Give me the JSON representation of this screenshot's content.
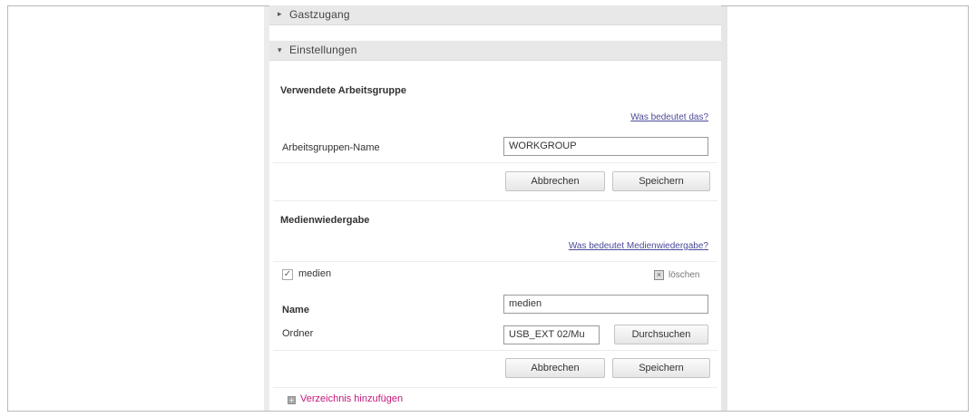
{
  "sections": {
    "guest_access": {
      "arrow": "▸",
      "title": "Gastzugang"
    },
    "settings": {
      "arrow": "▾",
      "title": "Einstellungen"
    }
  },
  "workgroup": {
    "heading": "Verwendete Arbeitsgruppe",
    "help_link": "Was bedeutet das?",
    "name_label": "Arbeitsgruppen-Name",
    "name_value": "WORKGROUP",
    "cancel_label": "Abbrechen",
    "save_label": "Speichern"
  },
  "media": {
    "heading": "Medienwiedergabe",
    "help_link": "Was bedeutet Medienwiedergabe?",
    "share_name": "medien",
    "share_checked": true,
    "delete_label": "löschen",
    "name_label": "Name",
    "name_value": "medien",
    "folder_label": "Ordner",
    "folder_value": "USB_EXT 02/Mu",
    "browse_label": "Durchsuchen",
    "cancel_label": "Abbrechen",
    "save_label": "Speichern"
  },
  "add_directory": {
    "label": "Verzeichnis hinzufügen"
  },
  "colors": {
    "link": "#4a4a9a",
    "add_link": "#c2187a",
    "section_bar": "#e8e8e8"
  }
}
